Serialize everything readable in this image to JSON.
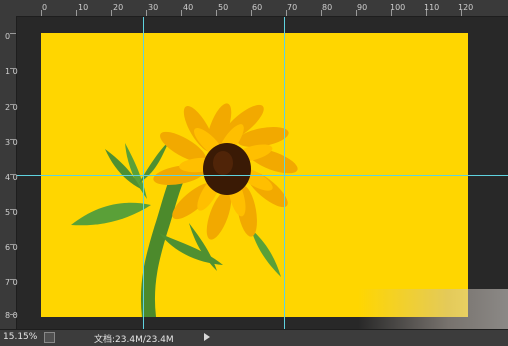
{
  "ruler": {
    "top_labels": [
      "0",
      "10",
      "20",
      "30",
      "40",
      "50",
      "60",
      "70",
      "80",
      "90",
      "100",
      "110",
      "120"
    ],
    "left_labels": [
      "0",
      "1 0",
      "2 0",
      "3 0",
      "4 0",
      "5 0",
      "6 0",
      "7 0",
      "8 0"
    ]
  },
  "status": {
    "zoom": "15.15%",
    "doc_info": "文档:23.4M/23.4M"
  },
  "colors": {
    "background": "#ffd600",
    "guide": "#5fd2e0",
    "petal": "#f2a900",
    "center": "#3a1a05",
    "stem": "#4c8a2c"
  },
  "icons": {
    "nav": "navigator-icon",
    "menu": "play-arrow-icon"
  }
}
